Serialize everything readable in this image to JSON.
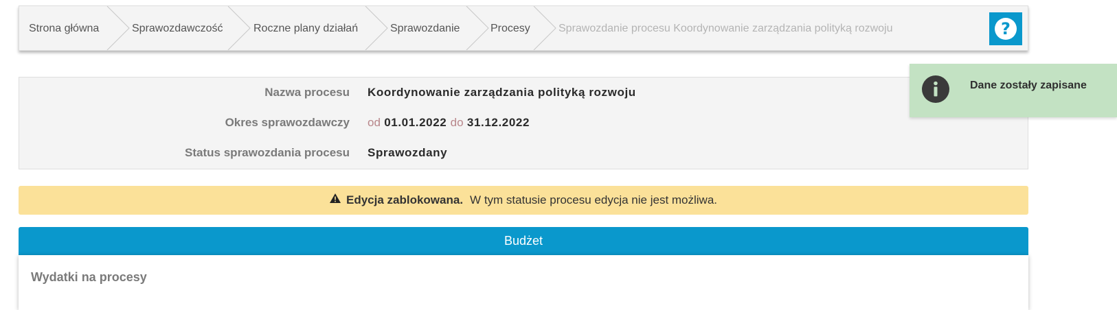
{
  "breadcrumb": {
    "items": [
      "Strona główna",
      "Sprawozdawczość",
      "Roczne plany działań",
      "Sprawozdanie",
      "Procesy"
    ],
    "current": "Sprawozdanie procesu Koordynowanie zarządzania polityką rozwoju"
  },
  "help": {
    "icon": "question-circle-icon",
    "glyph": "?"
  },
  "details": {
    "process_name_label": "Nazwa procesu",
    "process_name_value": "Koordynowanie zarządzania polityką rozwoju",
    "period_label": "Okres sprawozdawczy",
    "period_from_word": "od",
    "period_from": "01.01.2022",
    "period_to_word": "do",
    "period_to": "31.12.2022",
    "status_label": "Status sprawozdania procesu",
    "status_value": "Sprawozdany"
  },
  "warning": {
    "icon": "warning-triangle-icon",
    "title": "Edycja zablokowana.",
    "message": "W tym statusie procesu edycja nie jest możliwa."
  },
  "budget": {
    "header": "Budżet",
    "subtitle": "Wydatki na procesy"
  },
  "toast": {
    "icon": "info-circle-icon",
    "message": "Dane zostały zapisane"
  },
  "colors": {
    "accent": "#0a98cc",
    "warning_bg": "#fbe199",
    "toast_bg": "#c3e2c3",
    "panel_bg": "#f4f4f4"
  }
}
